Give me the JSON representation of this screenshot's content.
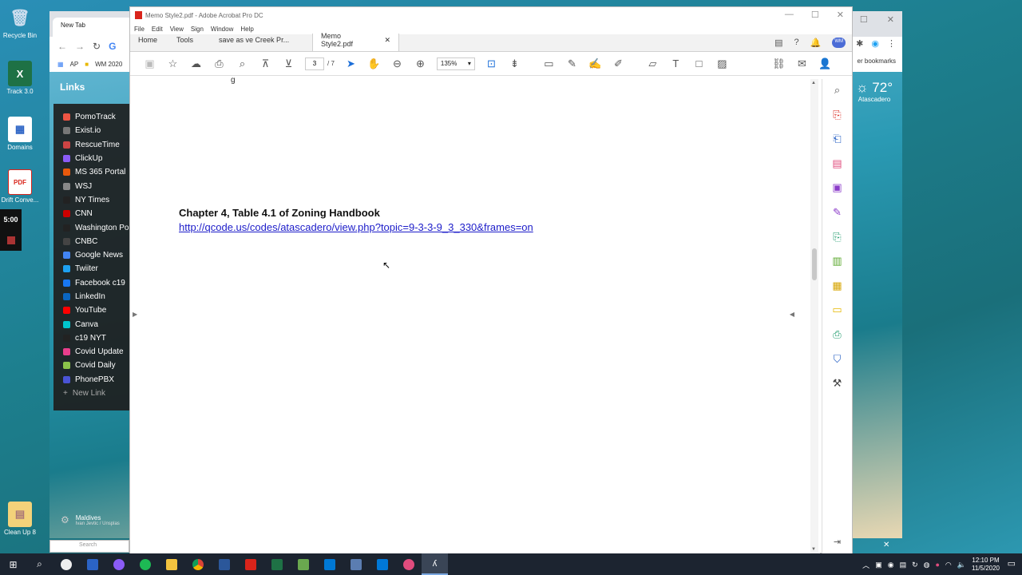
{
  "desktop": {
    "icons": [
      {
        "label": "Recycle Bin",
        "glyph": "🗑",
        "color": "#9ab"
      },
      {
        "label": "Track 3.0",
        "glyph": "X",
        "color": "#1e7145"
      },
      {
        "label": "Domains",
        "glyph": "▦",
        "color": "#2b63c5"
      },
      {
        "label": "Drift Conve...",
        "glyph": "PDF",
        "color": "#d9241b"
      },
      {
        "label": "Clean Up 8",
        "glyph": "▤",
        "color": "#e6c170"
      }
    ],
    "timer": "5:00"
  },
  "chrome": {
    "tab_title": "New Tab",
    "bookmarks": [
      "AP",
      "WM 2020"
    ],
    "other_bookmarks": "er bookmarks",
    "weather_temp": "72°",
    "weather_city": "Atascadero",
    "links_title": "Links",
    "links": [
      {
        "label": "PomoTrack",
        "color": "#e54"
      },
      {
        "label": "Exist.io",
        "color": "#777"
      },
      {
        "label": "RescueTime",
        "color": "#c44"
      },
      {
        "label": "ClickUp",
        "color": "#8b5cf6"
      },
      {
        "label": "MS 365 Portal",
        "color": "#e8590c"
      },
      {
        "label": "WSJ",
        "color": "#888"
      },
      {
        "label": "NY Times",
        "color": "#222"
      },
      {
        "label": "CNN",
        "color": "#cc0000"
      },
      {
        "label": "Washington Po",
        "color": "#222"
      },
      {
        "label": "CNBC",
        "color": "#444"
      },
      {
        "label": "Google News",
        "color": "#4285f4"
      },
      {
        "label": "Twiiter",
        "color": "#1da1f2"
      },
      {
        "label": "Facebook c19",
        "color": "#1877f2"
      },
      {
        "label": "LinkedIn",
        "color": "#0a66c2"
      },
      {
        "label": "YouTube",
        "color": "#ff0000"
      },
      {
        "label": "Canva",
        "color": "#00c4cc"
      },
      {
        "label": "c19 NYT",
        "color": "#222"
      },
      {
        "label": "Covid Update",
        "color": "#e83e8c"
      },
      {
        "label": "Covid Daily",
        "color": "#8bc34a"
      },
      {
        "label": "PhonePBX",
        "color": "#4a54d6"
      }
    ],
    "new_link": "New Link",
    "background_title": "Maldives",
    "background_credit": "Ivan Jevtic / Unsplas",
    "search_placeholder": "Search"
  },
  "acrobat": {
    "window_title": "Memo Style2.pdf - Adobe Acrobat Pro DC",
    "menu": [
      "File",
      "Edit",
      "View",
      "Sign",
      "Window",
      "Help"
    ],
    "tabs": {
      "home": "Home",
      "tools": "Tools",
      "doc1": "save as ve Creek Pr...",
      "doc2": "Memo Style2.pdf"
    },
    "page_current": "3",
    "page_total": "/ 7",
    "zoom": "135%",
    "document": {
      "fragment": "g",
      "heading": "Chapter 4, Table 4.1 of Zoning Handbook",
      "link": "http://qcode.us/codes/atascadero/view.php?topic=9-3-3-9_3_330&frames=on"
    }
  },
  "taskbar": {
    "time": "12:10 PM",
    "date": "11/5/2020"
  }
}
